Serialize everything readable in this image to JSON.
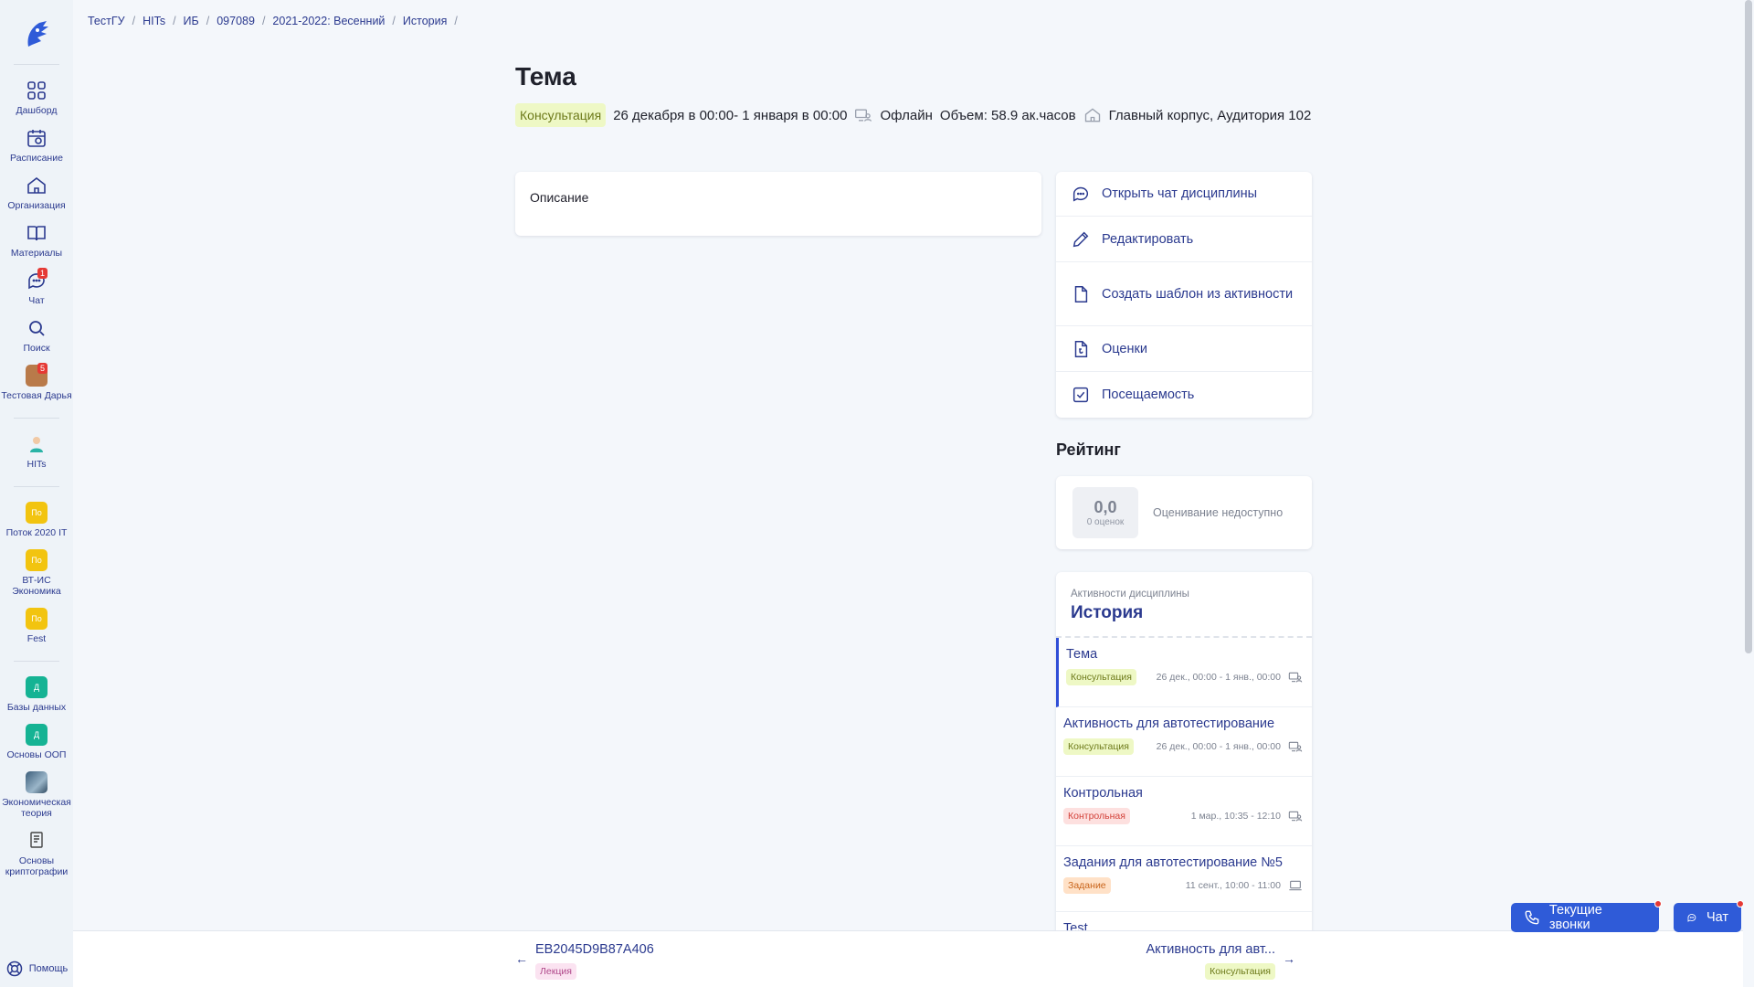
{
  "sidebar": {
    "items": [
      {
        "label": "Дашборд",
        "icon": "dashboard-icon"
      },
      {
        "label": "Расписание",
        "icon": "calendar-icon"
      },
      {
        "label": "Организация",
        "icon": "home-icon"
      },
      {
        "label": "Материалы",
        "icon": "book-icon"
      },
      {
        "label": "Чат",
        "icon": "chat-icon",
        "badge": "1"
      },
      {
        "label": "Поиск",
        "icon": "search-icon"
      }
    ],
    "profile": {
      "label": "Тестовая Дарья",
      "badge": "5"
    },
    "hits": {
      "label": "HITs"
    },
    "groups": [
      {
        "avatar": "По",
        "label": "Поток 2020 IT"
      },
      {
        "avatar": "По",
        "label": "ВТ-ИС Экономика"
      },
      {
        "avatar": "По",
        "label": "Fest"
      }
    ],
    "disciplines": [
      {
        "avatar": "Д",
        "label": "Базы данных"
      },
      {
        "avatar": "Д",
        "label": "Основы ООП"
      },
      {
        "avatar": "",
        "label": "Экономическая теория"
      },
      {
        "avatar": "",
        "label": "Основы криптографии"
      }
    ],
    "help": "Помощь"
  },
  "breadcrumb": [
    "ТестГУ",
    "HITs",
    "ИБ",
    "097089",
    "2021-2022: Весенний",
    "История"
  ],
  "header": {
    "title": "Тема",
    "type": "Консультация",
    "dates": "26 декабря в 00:00- 1 января в 00:00",
    "format": "Офлайн",
    "volume": "Объем: 58.9 ак.часов",
    "location": "Главный корпус, Аудитория 102"
  },
  "description": {
    "label": "Описание"
  },
  "actions": [
    {
      "label": "Открыть чат дисциплины",
      "icon": "chat-bubble-icon"
    },
    {
      "label": "Редактировать",
      "icon": "pencil-icon"
    },
    {
      "label": "Создать шаблон из активности",
      "icon": "document-icon"
    },
    {
      "label": "Оценки",
      "icon": "grade-document-icon"
    },
    {
      "label": "Посещаемость",
      "icon": "checkbox-icon"
    }
  ],
  "rating": {
    "title": "Рейтинг",
    "value": "0,0",
    "count": "0 оценок",
    "status": "Оценивание недоступно"
  },
  "activities": {
    "subtitle": "Активности дисциплины",
    "discipline": "История",
    "items": [
      {
        "name": "Тема",
        "type": "Консультация",
        "time": "26 дек., 00:00 - 1 янв., 00:00",
        "active": true
      },
      {
        "name": "Активность для автотестирование",
        "type": "Консультация",
        "time": "26 дек., 00:00 - 1 янв., 00:00"
      },
      {
        "name": "Контрольная",
        "type": "Контрольная",
        "time": "1 мар., 10:35 - 12:10"
      },
      {
        "name": "Задания для автотестирование №5",
        "type": "Задание",
        "time": "11 сент., 10:00 - 11:00"
      },
      {
        "name": "Test",
        "type": "",
        "time": ""
      }
    ]
  },
  "bottom": {
    "prev": {
      "code": "EB2045D9B87A406",
      "type": "Лекция"
    },
    "next": {
      "code": "Активность для авт...",
      "type": "Консультация"
    }
  },
  "floating": {
    "calls": "Текущие звонки",
    "chat": "Чат"
  },
  "colors": {
    "accent": "#2f5bd8",
    "link": "#2b3a8f",
    "consult_bg": "#eef8c5",
    "lecture_bg": "#fbe3f1",
    "control_bg": "#fde0df",
    "task_bg": "#ffe1c7"
  }
}
